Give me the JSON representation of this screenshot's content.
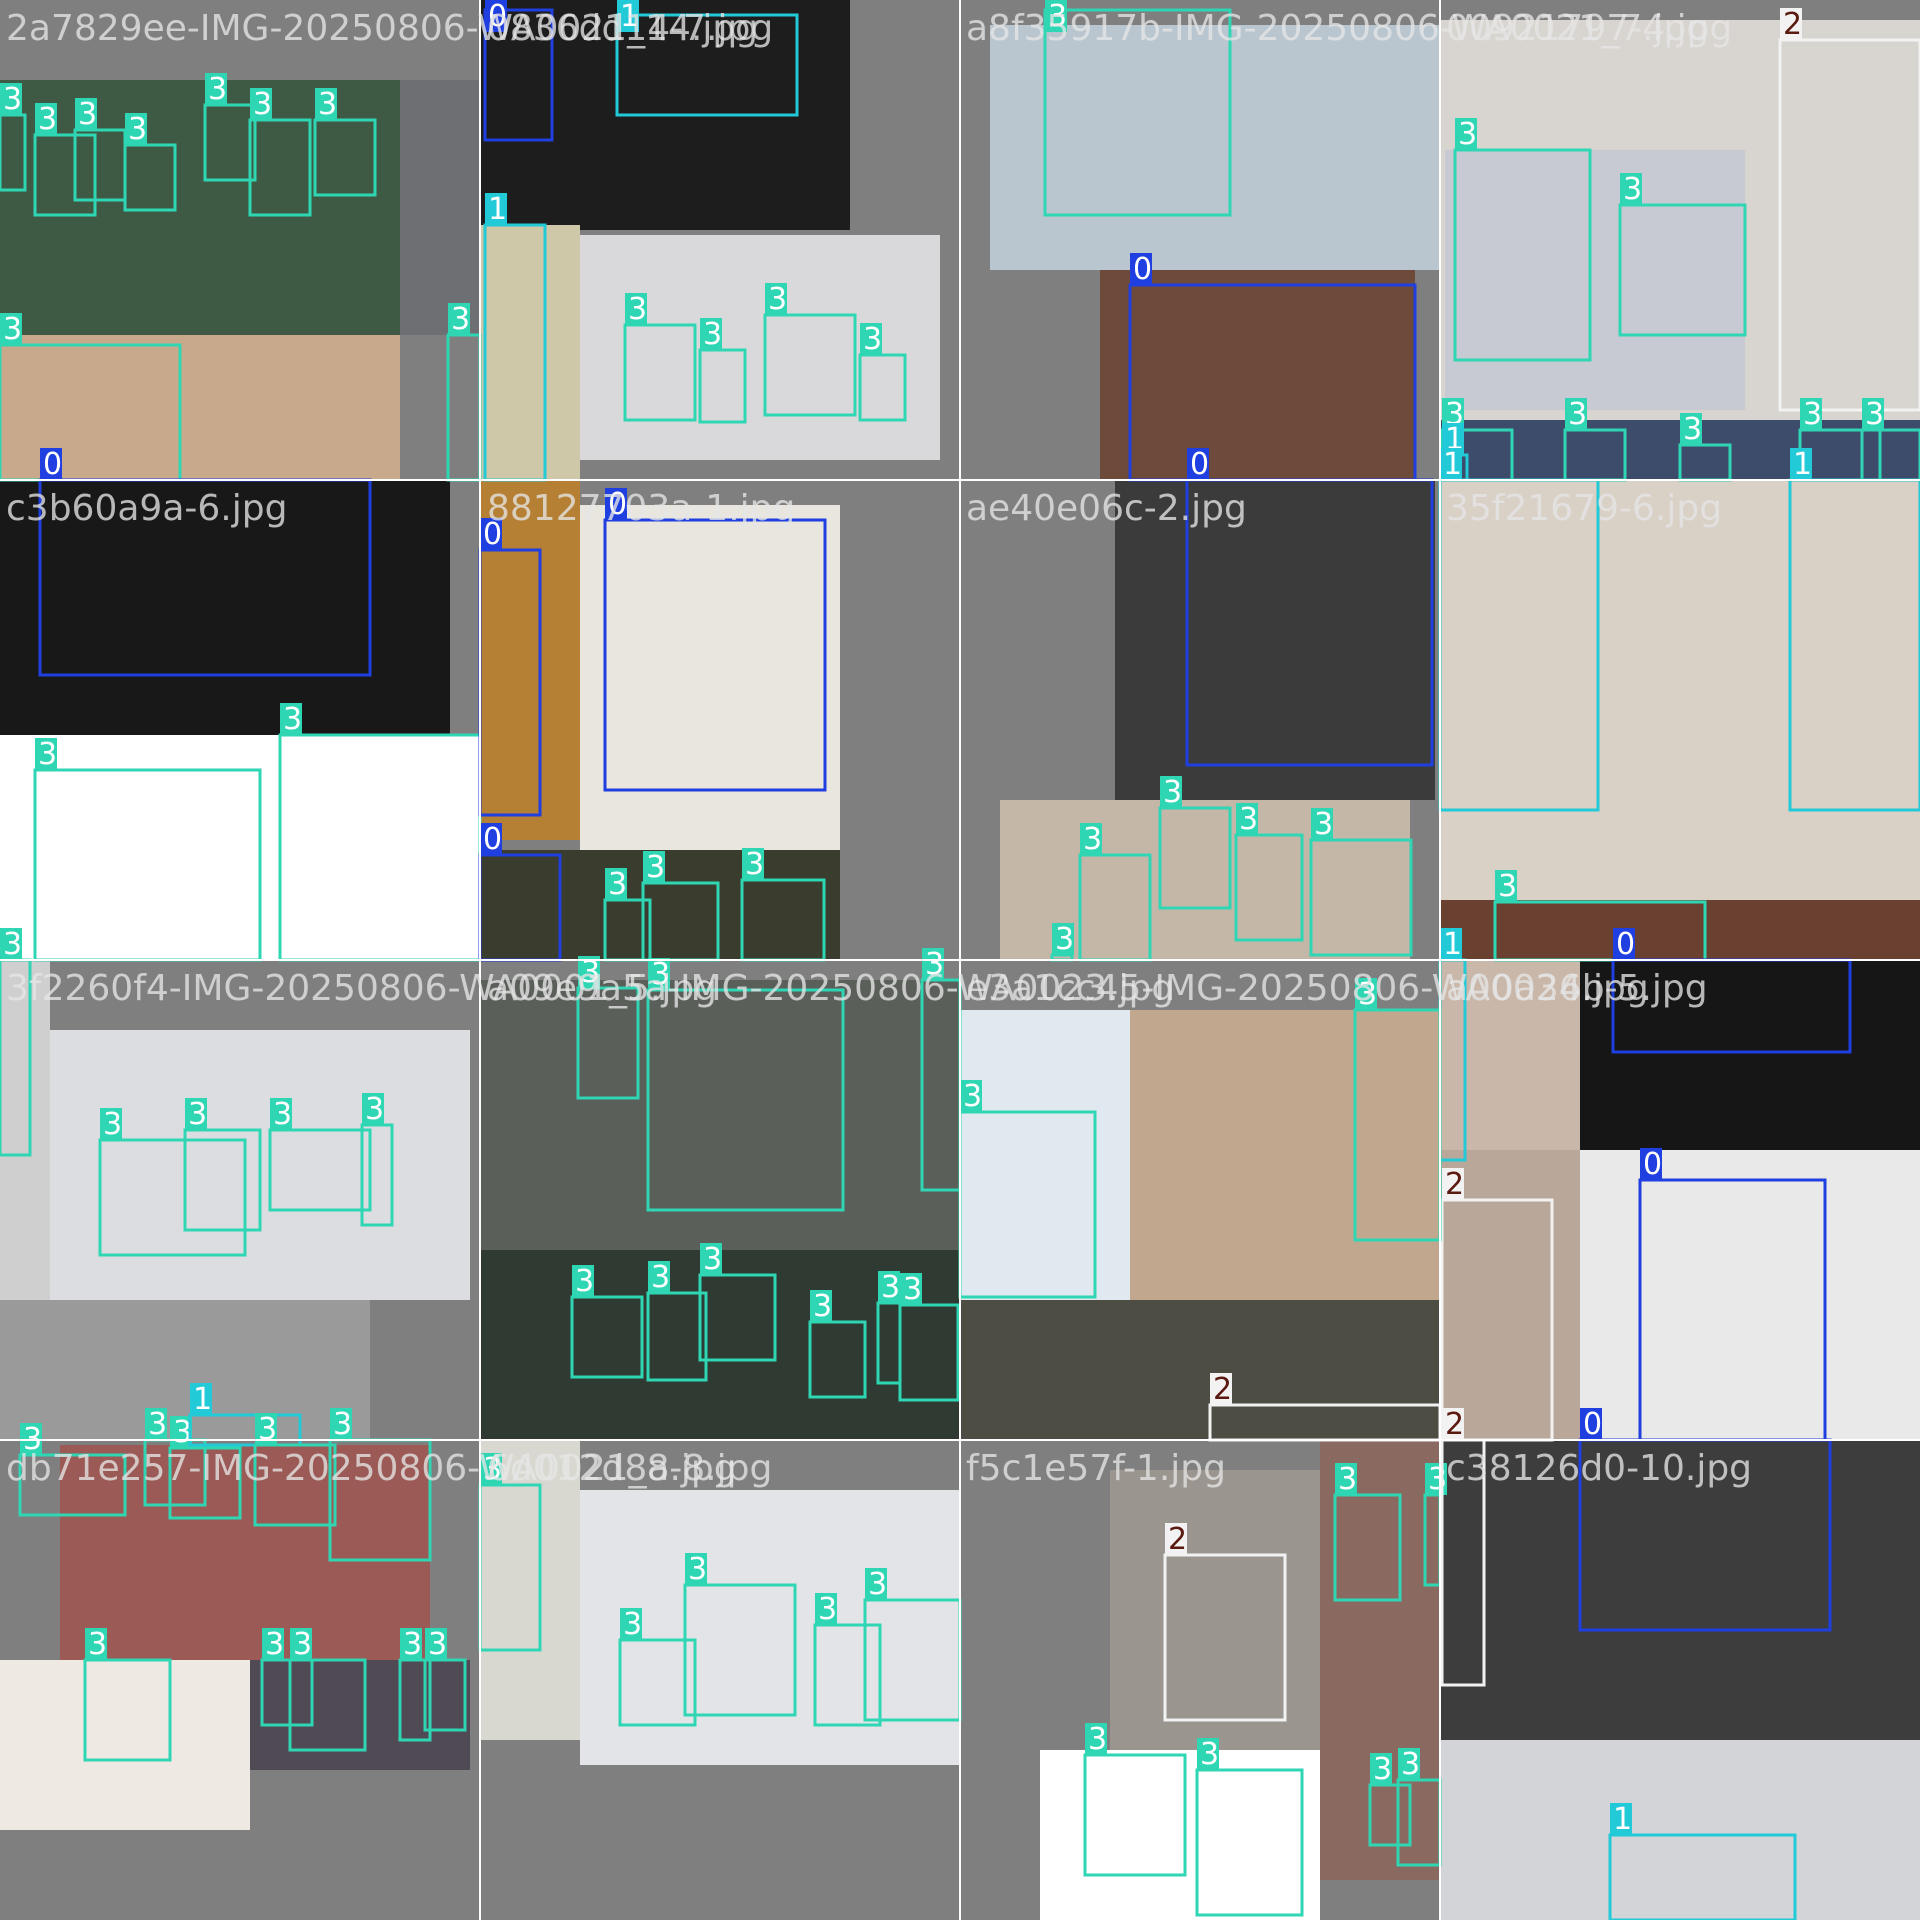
{
  "image_title": "",
  "classes": {
    "0": {
      "name": "0",
      "color": "#1f3fe0",
      "text_color": "#ffffff"
    },
    "1": {
      "name": "1",
      "color": "#22c9d6",
      "text_color": "#ffffff"
    },
    "2": {
      "name": "2",
      "color": "#f2f2f2",
      "text_color": "#5a1a10"
    },
    "3": {
      "name": "3",
      "color": "#2fd6b4",
      "text_color": "#ffffff"
    }
  },
  "tiles": [
    {
      "title": "2a7829ee-IMG-20250806-WA0021_14.jpg"
    },
    {
      "title": "0836dd14-7.jpg"
    },
    {
      "title": "a8f35917b-IMG-20250806-WA0021_7.jpg"
    },
    {
      "title": "00921797-4.jpg"
    },
    {
      "title": "c3b60a9a-6.jpg"
    },
    {
      "title": "88127703a-1.jpg"
    },
    {
      "title": "ae40e06c-2.jpg"
    },
    {
      "title": "35f21679-6.jpg"
    },
    {
      "title": "3f2260f4-IMG-20250806-WA0001_5.jpg"
    },
    {
      "title": "a09e9a5a-IMG-20250806-WA0023.jpg"
    },
    {
      "title": "e3a1cc45-IMG-20250806-WA0024.jpg"
    },
    {
      "title": "a00a36b-5.jpg"
    },
    {
      "title": "db71e257-IMG-20250806-WA0021_8.jpg"
    },
    {
      "title": "6d012d8a-8.jpg"
    },
    {
      "title": "f5c1e57f-1.jpg"
    },
    {
      "title": "c38126d0-10.jpg"
    }
  ]
}
